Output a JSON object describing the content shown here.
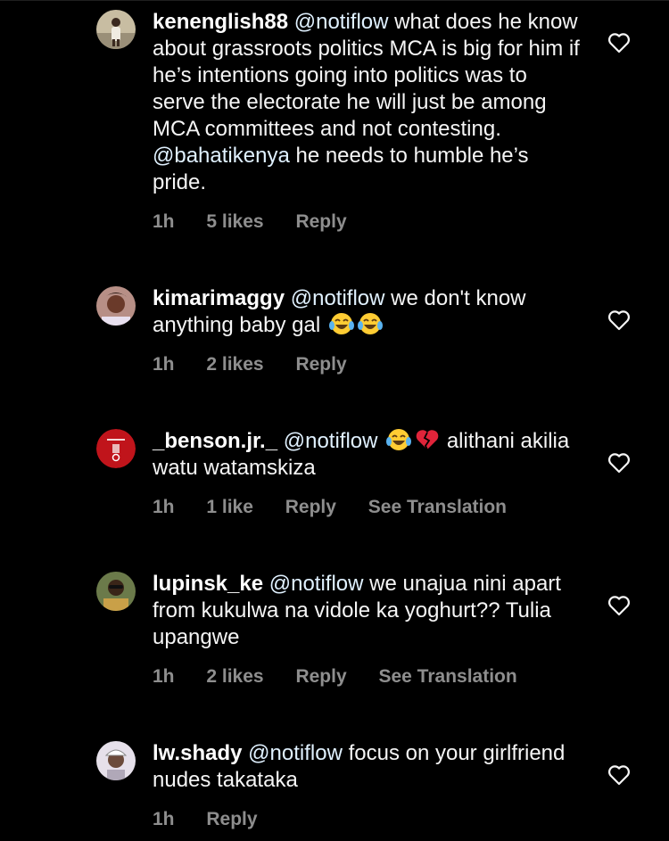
{
  "colors": {
    "background": "#000000",
    "text": "#f5f5f5",
    "meta": "#8e8e8e",
    "mention": "#e0f1ff"
  },
  "comments": [
    {
      "username": "kenenglish88",
      "mention": "@notiflow",
      "text_a": " what does he know about grassroots politics MCA is big for him if he’s intentions going into politics was to serve the electorate he will just be among MCA committees and not contesting. ",
      "mention_b": "@bahatikenya",
      "text_b": " he needs to humble he’s pride.",
      "time": "1h",
      "likes": "5 likes",
      "reply": "Reply",
      "avatar_icon": "person-photo-avatar",
      "like_icon": "heart-outline-icon"
    },
    {
      "username": "kimarimaggy",
      "mention": "@notiflow",
      "text_a": " we don't know anything baby gal ",
      "emojis": [
        "tears-of-joy-emoji",
        "tears-of-joy-emoji"
      ],
      "time": "1h",
      "likes": "2 likes",
      "reply": "Reply",
      "avatar_icon": "woman-photo-avatar",
      "like_icon": "heart-outline-icon"
    },
    {
      "username": "_benson.jr._",
      "mention": "@notiflow",
      "emojis": [
        "tears-of-joy-emoji",
        "broken-heart-emoji"
      ],
      "text_a": " alithani akilia watu watamskiza",
      "time": "1h",
      "likes": "1 like",
      "reply": "Reply",
      "translate": "See Translation",
      "avatar_icon": "red-jersey-avatar",
      "like_icon": "heart-outline-icon"
    },
    {
      "username": "lupinsk_ke",
      "mention": "@notiflow",
      "text_a": " we unajua nini apart from kukulwa na vidole ka yoghurt?? Tulia upangwe",
      "time": "1h",
      "likes": "2 likes",
      "reply": "Reply",
      "translate": "See Translation",
      "avatar_icon": "man-photo-avatar",
      "like_icon": "heart-outline-icon"
    },
    {
      "username": "lw.shady",
      "mention": "@notiflow",
      "text_a": " focus on your girlfriend nudes takataka",
      "time": "1h",
      "reply": "Reply",
      "avatar_icon": "cartoon-avatar",
      "like_icon": "heart-outline-icon"
    }
  ]
}
